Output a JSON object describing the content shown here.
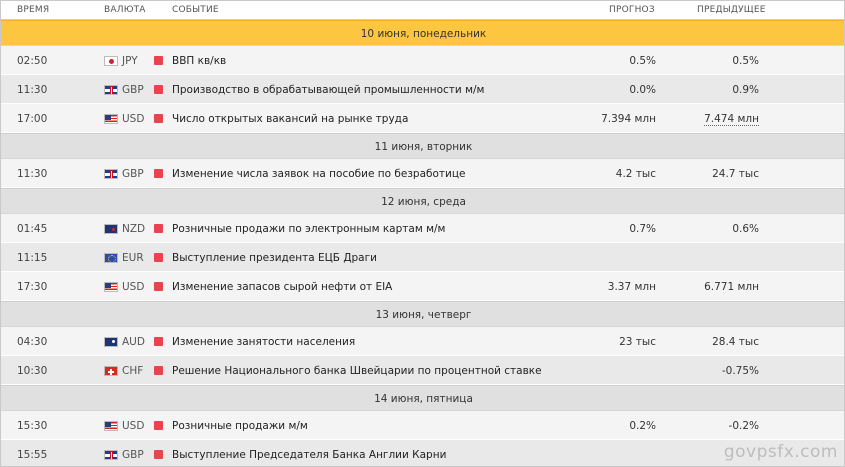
{
  "header": {
    "time": "ВРЕМЯ",
    "currency": "ВАЛЮТА",
    "event": "СОБЫТИЕ",
    "forecast": "ПРОГНОЗ",
    "previous": "ПРЕДЫДУЩЕЕ"
  },
  "colors": {
    "first_day_bg": "#fcc640",
    "day_bg": "#e0e0e0",
    "importance_high": "#e8434f"
  },
  "days": [
    {
      "label": "10 июня, понедельник",
      "events": [
        {
          "time": "02:50",
          "currency": "JPY",
          "flag": "jp-flag-icon",
          "event": "ВВП кв/кв",
          "forecast": "0.5%",
          "previous": "0.5%"
        },
        {
          "time": "11:30",
          "currency": "GBP",
          "flag": "gb-flag-icon",
          "event": "Производство в обрабатывающей промышленности м/м",
          "forecast": "0.0%",
          "previous": "0.9%"
        },
        {
          "time": "17:00",
          "currency": "USD",
          "flag": "us-flag-icon",
          "event": "Число открытых вакансий на рынке труда",
          "forecast": "7.394 млн",
          "previous": "7.474 млн",
          "previous_dotted": true
        }
      ]
    },
    {
      "label": "11 июня, вторник",
      "events": [
        {
          "time": "11:30",
          "currency": "GBP",
          "flag": "gb-flag-icon",
          "event": "Изменение числа заявок на пособие по безработице",
          "forecast": "4.2 тыс",
          "previous": "24.7 тыс"
        }
      ]
    },
    {
      "label": "12 июня, среда",
      "events": [
        {
          "time": "01:45",
          "currency": "NZD",
          "flag": "nz-flag-icon",
          "event": "Розничные продажи по электронным картам м/м",
          "forecast": "0.7%",
          "previous": "0.6%"
        },
        {
          "time": "11:15",
          "currency": "EUR",
          "flag": "eu-flag-icon",
          "event": "Выступление президента ЕЦБ Драги",
          "forecast": "",
          "previous": ""
        },
        {
          "time": "17:30",
          "currency": "USD",
          "flag": "us-flag-icon",
          "event": "Изменение запасов сырой нефти от EIA",
          "forecast": "3.37 млн",
          "previous": "6.771 млн"
        }
      ]
    },
    {
      "label": "13 июня, четверг",
      "events": [
        {
          "time": "04:30",
          "currency": "AUD",
          "flag": "au-flag-icon",
          "event": "Изменение занятости населения",
          "forecast": "23 тыс",
          "previous": "28.4 тыс"
        },
        {
          "time": "10:30",
          "currency": "CHF",
          "flag": "ch-flag-icon",
          "event": "Решение Национального банка Швейцарии по процентной ставке",
          "forecast": "",
          "previous": "-0.75%"
        }
      ]
    },
    {
      "label": "14 июня, пятница",
      "events": [
        {
          "time": "15:30",
          "currency": "USD",
          "flag": "us-flag-icon",
          "event": "Розничные продажи м/м",
          "forecast": "0.2%",
          "previous": "-0.2%"
        },
        {
          "time": "15:55",
          "currency": "GBP",
          "flag": "gb-flag-icon",
          "event": "Выступление Председателя Банка Англии Карни",
          "forecast": "",
          "previous": ""
        }
      ]
    }
  ],
  "watermark": "govpsfx.com"
}
